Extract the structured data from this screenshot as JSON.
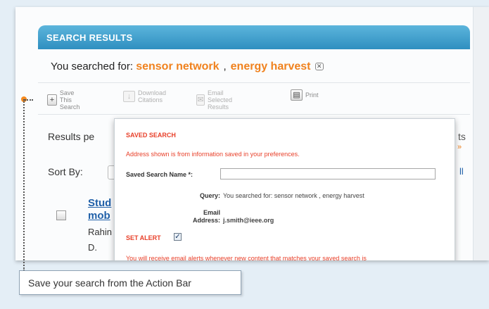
{
  "header": {
    "title": "SEARCH RESULTS"
  },
  "searched": {
    "prefix": "You searched for:",
    "term1": "sensor network",
    "separator": ",",
    "term2": "energy harvest",
    "clear_icon": "close-icon"
  },
  "action_bar": {
    "save_line1": "Save This",
    "save_line2": "Search",
    "download_line1": "Download",
    "download_line2": "Citations",
    "email_line1": "Email Selected",
    "email_line2": "Results",
    "print": "Print"
  },
  "background": {
    "results_per": "Results pe",
    "sort_by": "Sort By:",
    "title_frag1": "Stud",
    "title_frag2": "mob",
    "author_frag1": "Rahin",
    "author_frag2": "D.",
    "right_frag1": "ts",
    "right_frag2": "»",
    "right_frag3": "ll"
  },
  "popup": {
    "title": "SAVED SEARCH",
    "note": "Address shown is from information saved in your preferences.",
    "name_label": "Saved Search Name *:",
    "name_value": "",
    "query_label": "Query:",
    "query_value": "You searched for: sensor network ,  energy harvest",
    "email_label_1": "Email",
    "email_label_2": "Address:",
    "email_value": "j.smith@ieee.org",
    "alert_title": "SET ALERT",
    "alert_checked": true,
    "alert_text": "You will receive email alerts whenever new content that matches your saved search is"
  },
  "callout": {
    "text": "Save your search from the Action Bar"
  },
  "colors": {
    "accent": "#f0821e",
    "header_blue": "#3a9acb",
    "error_red": "#e8402a",
    "link_blue": "#1f5fa8"
  }
}
